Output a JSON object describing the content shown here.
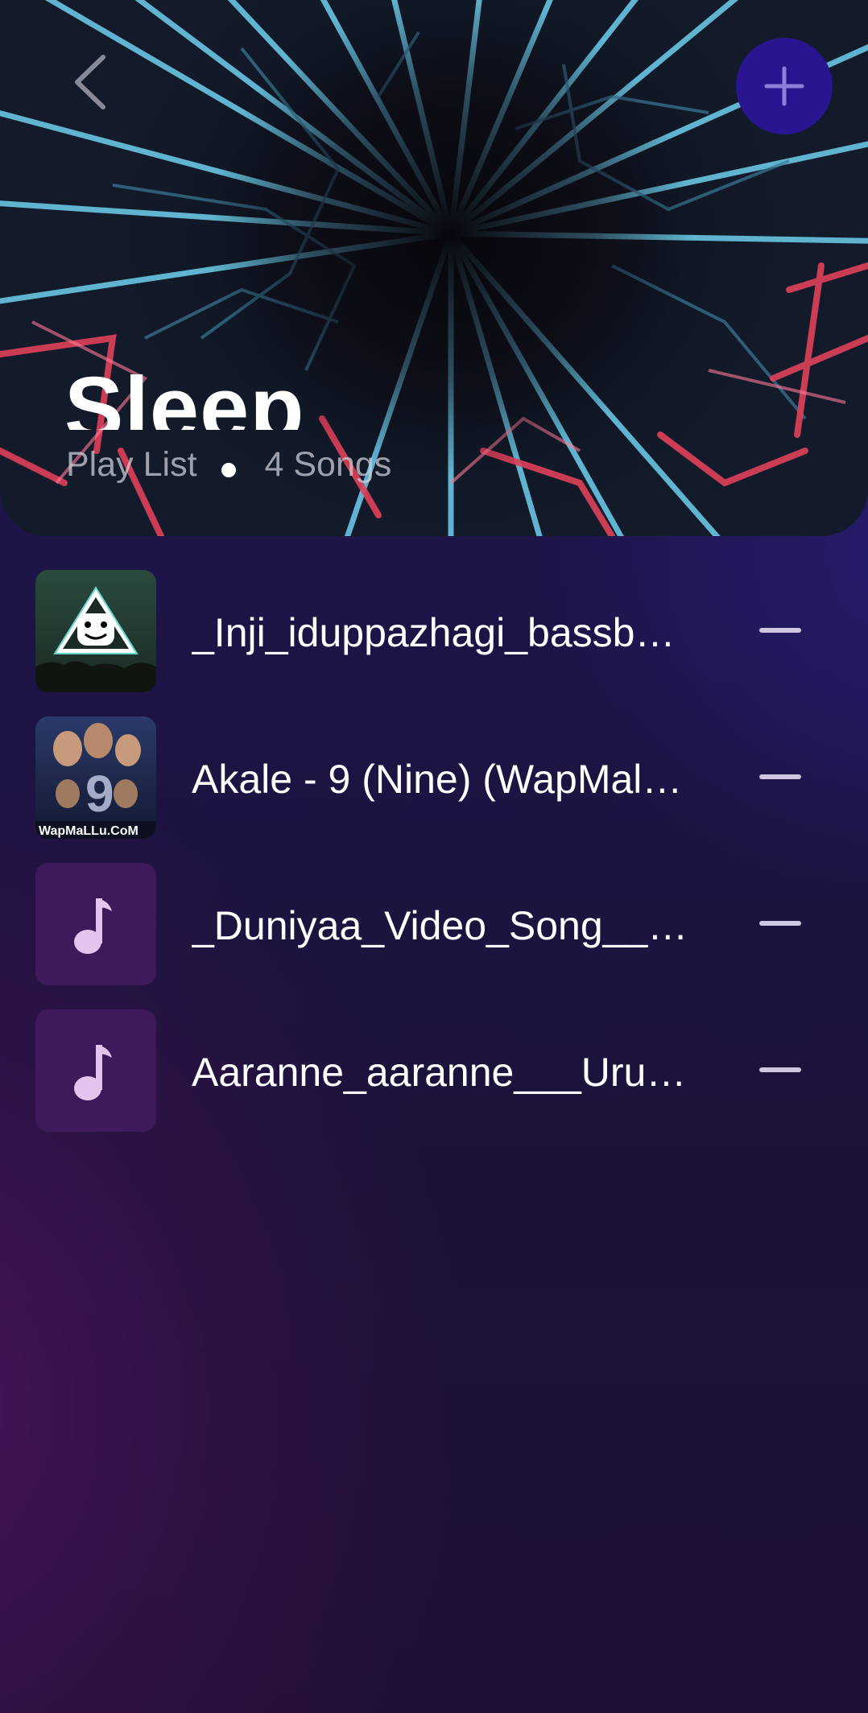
{
  "playlist": {
    "title": "Sleep",
    "type_label": "Play List",
    "song_count": "4 Songs"
  },
  "icons": {
    "back": "chevron-left-icon",
    "add": "plus-icon",
    "remove": "minus-icon",
    "placeholder": "music-note-icon"
  },
  "colors": {
    "accent": "#2a1590",
    "placeholder_bg": "#3f1a5a",
    "placeholder_note": "#e2c4ee"
  },
  "songs": [
    {
      "title": "_Inji_iduppazhagi_bassb…",
      "thumbnail": "marshmello-artwork"
    },
    {
      "title": "Akale - 9 (Nine) (WapMal…",
      "thumbnail": "nine-movie-poster",
      "thumbnail_text": "WapMaLLu.CoM"
    },
    {
      "title": "_Duniyaa_Video_Song__…",
      "thumbnail": "music-note-placeholder"
    },
    {
      "title": "Aaranne_aaranne___Uru…",
      "thumbnail": "music-note-placeholder"
    }
  ]
}
